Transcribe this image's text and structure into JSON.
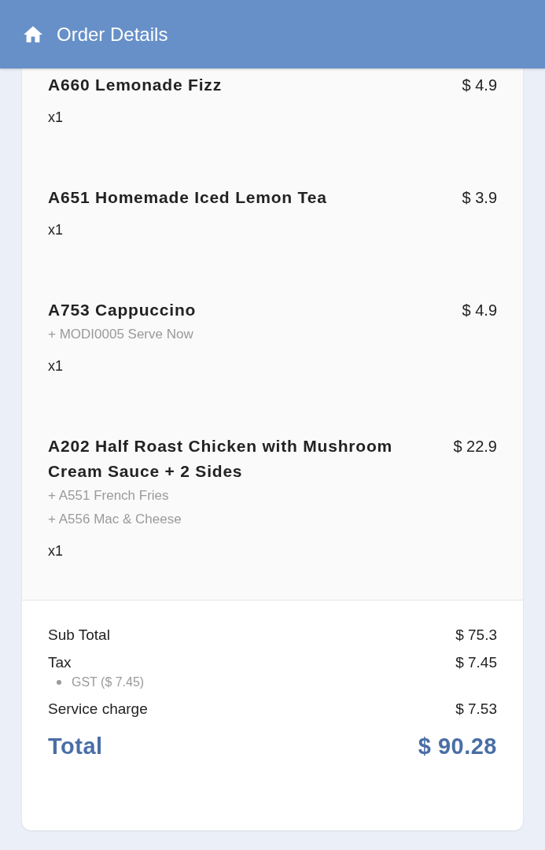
{
  "header": {
    "title": "Order Details"
  },
  "items": [
    {
      "name": "A660 Lemonade Fizz",
      "price": "$ 4.9",
      "quantity": "x1"
    },
    {
      "name": "A651 Homemade Iced Lemon Tea",
      "price": "$ 3.9",
      "quantity": "x1"
    },
    {
      "name": "A753 Cappuccino",
      "price": "$ 4.9",
      "modifiers": [
        "+ MODI0005 Serve Now"
      ],
      "quantity": "x1"
    },
    {
      "name": "A202 Half Roast Chicken with Mushroom Cream Sauce + 2 Sides",
      "price": "$ 22.9",
      "modifiers": [
        "+ A551 French Fries",
        "+ A556 Mac & Cheese"
      ],
      "quantity": "x1"
    }
  ],
  "totals": {
    "lines": [
      {
        "label": "Sub Total",
        "amount": "$ 75.3"
      },
      {
        "label": "Tax",
        "amount": "$ 7.45",
        "details": [
          "GST ($ 7.45)"
        ]
      },
      {
        "label": "Service charge",
        "amount": "$ 7.53"
      }
    ],
    "total": {
      "label": "Total",
      "amount": "$ 90.28"
    }
  }
}
